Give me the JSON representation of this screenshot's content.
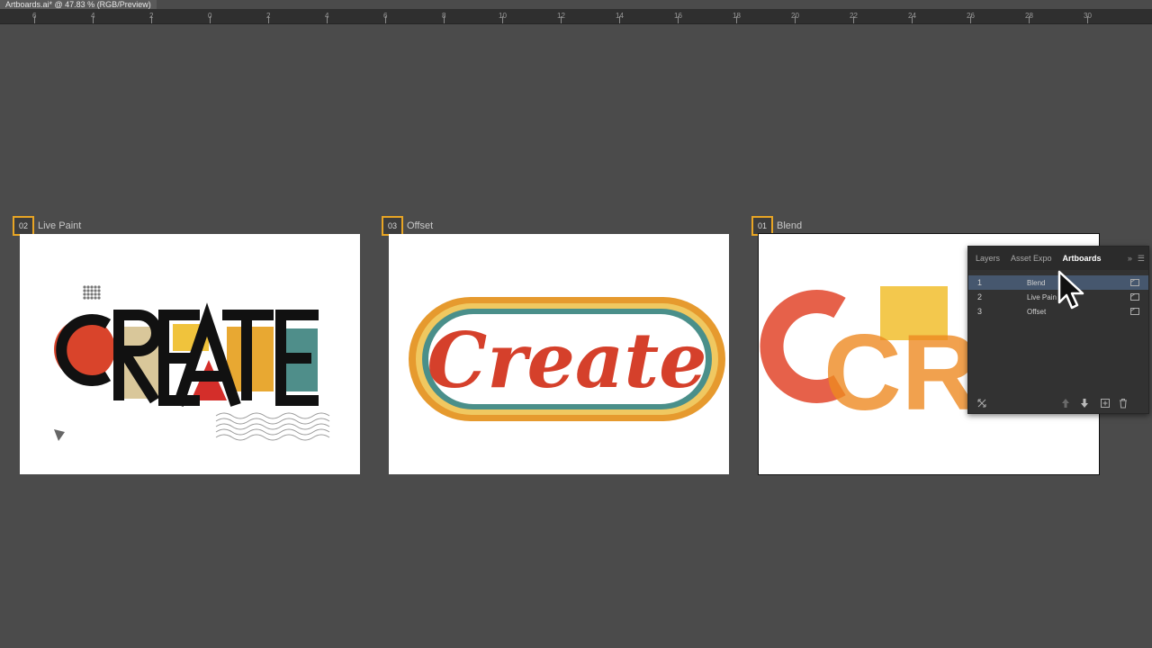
{
  "document_tab": {
    "title": "Artboards.ai* @ 47.83 % (RGB/Preview)"
  },
  "ruler": {
    "ticks": [
      "6",
      "4",
      "2",
      "0",
      "2",
      "4",
      "6",
      "8",
      "10",
      "12",
      "14",
      "16",
      "18",
      "20",
      "22",
      "24",
      "26",
      "28",
      "30"
    ]
  },
  "artboards": [
    {
      "number": "02",
      "name": "Live Paint",
      "artwork_text": "CREATE"
    },
    {
      "number": "03",
      "name": "Offset",
      "artwork_text": "Create"
    },
    {
      "number": "01",
      "name": "Blend",
      "artwork_text": "CREA"
    }
  ],
  "panel": {
    "tabs": [
      "Layers",
      "Asset Expo",
      "Artboards"
    ],
    "active_tab": "Artboards",
    "rows": [
      {
        "num": "1",
        "name": "Blend"
      },
      {
        "num": "2",
        "name": "Live Pain"
      },
      {
        "num": "3",
        "name": "Offset"
      }
    ]
  },
  "icons": {
    "collapse": "double-chevron-icon",
    "menu": "hamburger-menu-icon",
    "rearrange": "rearrange-artboards-icon",
    "move_up": "arrow-up-icon",
    "move_down": "arrow-down-icon",
    "new": "new-artboard-icon",
    "delete": "trash-icon"
  },
  "colors": {
    "canvas_bg": "#4b4b4b",
    "artboard_number_border": "#e8a524",
    "panel_bg": "#323232",
    "selection": "#46576e"
  }
}
